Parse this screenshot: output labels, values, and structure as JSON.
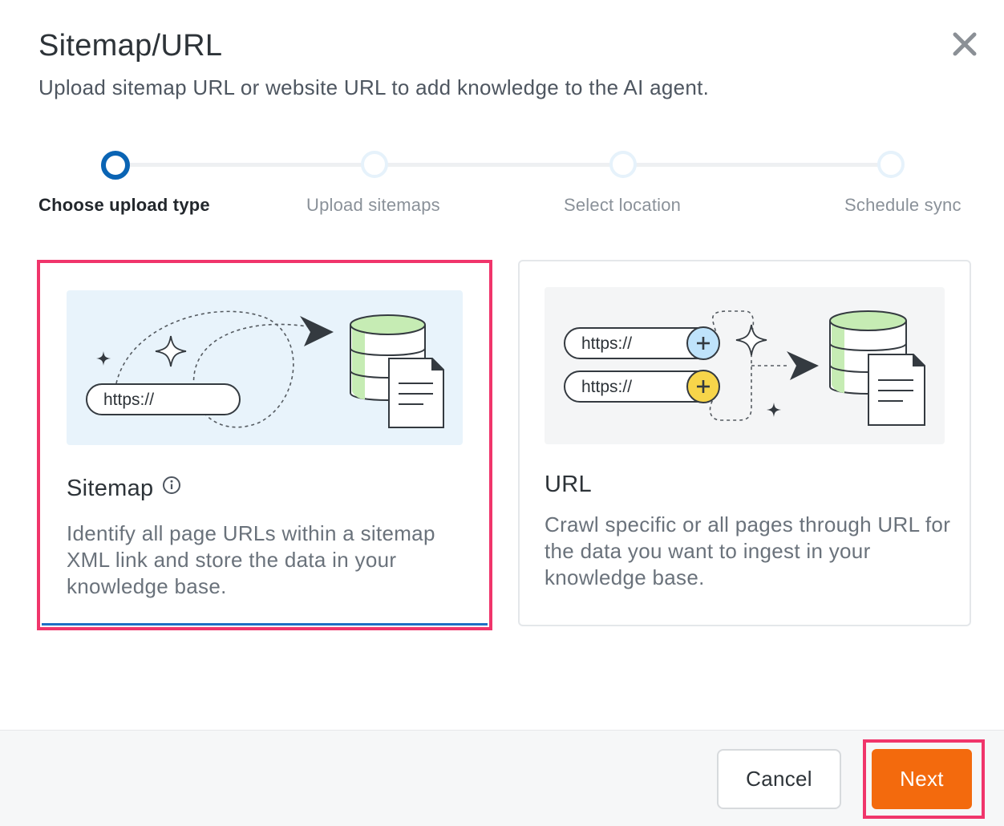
{
  "dialog": {
    "title": "Sitemap/URL",
    "subtitle": "Upload sitemap URL or website URL to add knowledge to the AI agent."
  },
  "stepper": {
    "steps": [
      {
        "label": "Choose upload type",
        "state": "active"
      },
      {
        "label": "Upload sitemaps",
        "state": "pending"
      },
      {
        "label": "Select location",
        "state": "pending"
      },
      {
        "label": "Schedule sync",
        "state": "pending"
      }
    ]
  },
  "options": [
    {
      "title": "Sitemap",
      "description": "Identify all page URLs within a sitemap XML link and store the data in your knowledge base.",
      "url_placeholder": "https://",
      "selected": true
    },
    {
      "title": "URL",
      "description": "Crawl specific or all pages through URL for the data you want to ingest in your knowledge base.",
      "url_placeholder": "https://",
      "selected": false
    }
  ],
  "footer": {
    "cancel_label": "Cancel",
    "next_label": "Next"
  },
  "colors": {
    "accent_active": "#0a64b4",
    "highlight": "#f0356b",
    "next_button": "#f36a0d",
    "db_green": "#c6ecb4",
    "plus_blue": "#bfe3fb",
    "plus_yellow": "#f7d54a"
  },
  "icons": {
    "close": "close-icon",
    "info": "info-icon",
    "database": "database-icon",
    "document": "document-icon",
    "sparkle": "sparkle-icon",
    "arrow": "arrow-icon",
    "plus": "plus-icon"
  }
}
